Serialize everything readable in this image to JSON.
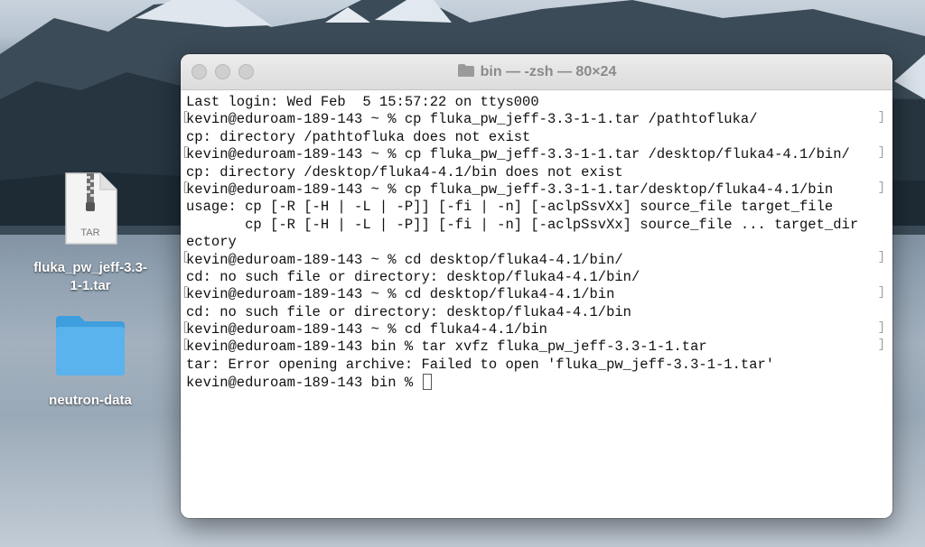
{
  "desktop": {
    "icons": [
      {
        "label_line1": "fluka_pw_jeff-3.3-",
        "label_line2": "1-1.tar",
        "badge": "TAR",
        "icon": "tar-archive-icon"
      },
      {
        "label": "neutron-data",
        "icon": "folder-icon"
      }
    ]
  },
  "window": {
    "title": "bin — -zsh — 80×24",
    "title_icon": "folder-icon",
    "lines": [
      "Last login: Wed Feb  5 15:57:22 on ttys000",
      "kevin@eduroam-189-143 ~ % cp fluka_pw_jeff-3.3-1-1.tar /pathtofluka/",
      "cp: directory /pathtofluka does not exist",
      "kevin@eduroam-189-143 ~ % cp fluka_pw_jeff-3.3-1-1.tar /desktop/fluka4-4.1/bin/",
      "cp: directory /desktop/fluka4-4.1/bin does not exist",
      "kevin@eduroam-189-143 ~ % cp fluka_pw_jeff-3.3-1-1.tar/desktop/fluka4-4.1/bin",
      "usage: cp [-R [-H | -L | -P]] [-fi | -n] [-aclpSsvXx] source_file target_file",
      "       cp [-R [-H | -L | -P]] [-fi | -n] [-aclpSsvXx] source_file ... target_dir",
      "ectory",
      "kevin@eduroam-189-143 ~ % cd desktop/fluka4-4.1/bin/",
      "cd: no such file or directory: desktop/fluka4-4.1/bin/",
      "kevin@eduroam-189-143 ~ % cd desktop/fluka4-4.1/bin",
      "cd: no such file or directory: desktop/fluka4-4.1/bin",
      "kevin@eduroam-189-143 ~ % cd fluka4-4.1/bin",
      "kevin@eduroam-189-143 bin % tar xvfz fluka_pw_jeff-3.3-1-1.tar",
      "tar: Error opening archive: Failed to open 'fluka_pw_jeff-3.3-1-1.tar'",
      "kevin@eduroam-189-143 bin % "
    ],
    "colors": {
      "folder_blue": "#5ab3ec",
      "titlebar": "#e4e4e4",
      "text": "#111111"
    }
  }
}
